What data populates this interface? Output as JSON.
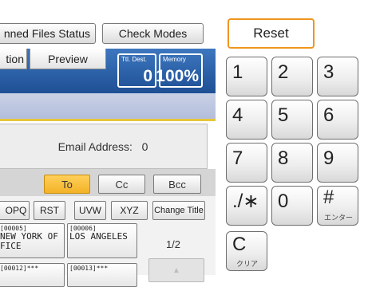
{
  "top_buttons": {
    "scanned_files_status": "nned Files Status",
    "check_modes": "Check Modes"
  },
  "tabs": {
    "option": "tion",
    "preview": "Preview"
  },
  "counters": {
    "total_dest_caption": "Ttl. Dest.",
    "total_dest_value": "0",
    "memory_caption": "Memory",
    "memory_value": "100%"
  },
  "email": {
    "label": "Email Address:",
    "count": "0"
  },
  "destination_type": {
    "to": "To",
    "cc": "Cc",
    "bcc": "Bcc"
  },
  "index_buttons": [
    "OPQ",
    "RST",
    "UVW",
    "XYZ",
    "Change Title"
  ],
  "address_entries": [
    {
      "number": "[00005]",
      "name": "NEW YORK OFFICE"
    },
    {
      "number": "[00006]",
      "name": "LOS ANGELES"
    },
    {
      "number": "[00012]***",
      "name": ""
    },
    {
      "number": "[00013]***",
      "name": ""
    }
  ],
  "page_indicator": "1/2",
  "keypad": {
    "reset": "Reset",
    "keys": {
      "k1": "1",
      "k2": "2",
      "k3": "3",
      "k4": "4",
      "k5": "5",
      "k6": "6",
      "k7": "7",
      "k8": "8",
      "k9": "9",
      "star": "./∗",
      "k0": "0",
      "hash": "#",
      "hash_sub": "エンター",
      "clear": "C",
      "clear_sub": "クリア"
    }
  },
  "colors": {
    "header_blue": "#2a5fa6",
    "accent_orange": "#f0951f",
    "active_yellow": "#f7bd3a",
    "band_yellow": "#e6c63b"
  },
  "icons": {
    "scroll_up": "triangle-up-icon"
  }
}
